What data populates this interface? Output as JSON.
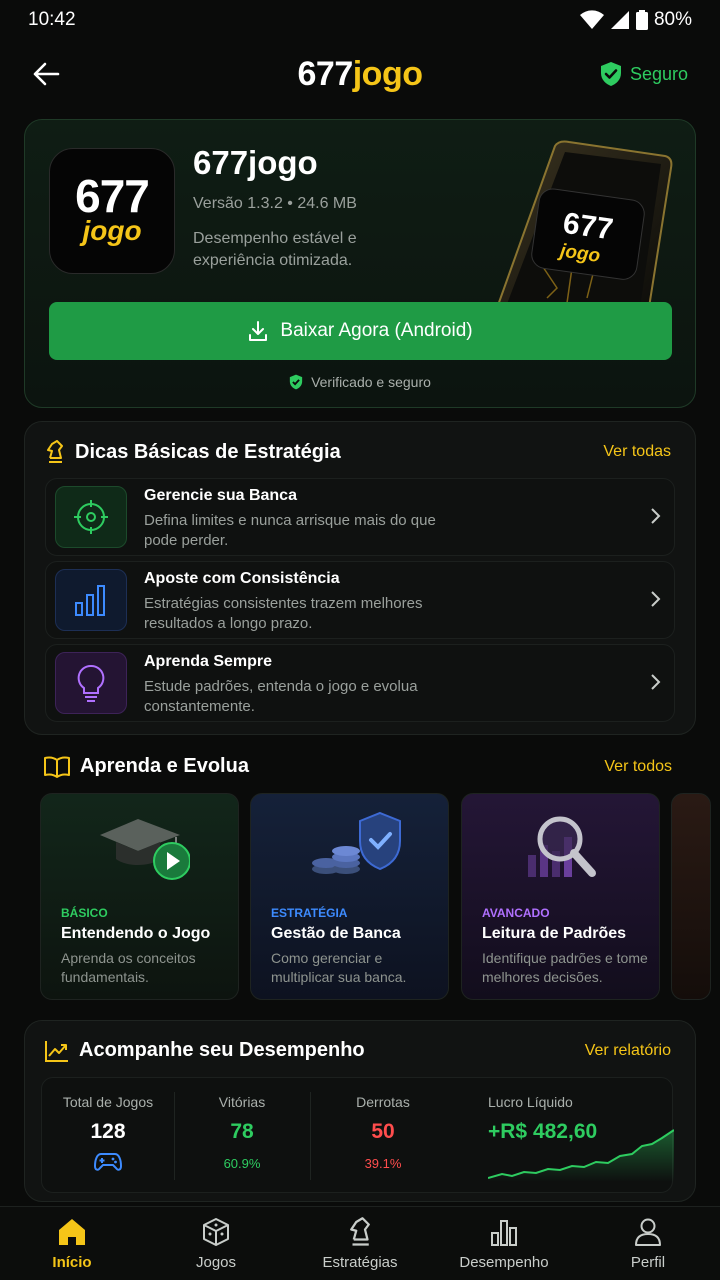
{
  "status": {
    "time": "10:42",
    "battery": "80%"
  },
  "appbar": {
    "brand_num": "677",
    "brand_word": "jogo",
    "safe_label": "Seguro"
  },
  "hero": {
    "icon_num": "677",
    "icon_word": "jogo",
    "name": "677jogo",
    "meta": "Versão 1.3.2  •  24.6 MB",
    "desc": "Desempenho estável e experiência otimizada.",
    "phone_num": "677",
    "phone_word": "jogo",
    "download_label": "Baixar Agora (Android)",
    "verified_label": "Verificado e seguro"
  },
  "tips": {
    "title": "Dicas Básicas de Estratégia",
    "link": "Ver todas",
    "items": [
      {
        "title": "Gerencie sua Banca",
        "sub": "Defina limites e nunca arrisque mais do que pode perder.",
        "icon": "target-icon"
      },
      {
        "title": "Aposte com Consistência",
        "sub": "Estratégias consistentes trazem melhores resultados a longo prazo.",
        "icon": "bar-chart-icon"
      },
      {
        "title": "Aprenda Sempre",
        "sub": "Estude padrões, entenda o jogo e evolua constantemente.",
        "icon": "lightbulb-icon"
      }
    ]
  },
  "learn": {
    "title": "Aprenda e Evolua",
    "link": "Ver todos",
    "cards": [
      {
        "tag": "BÁSICO",
        "title": "Entendendo o Jogo",
        "sub": "Aprenda os conceitos fundamentais.",
        "color": "#2ecc60"
      },
      {
        "tag": "ESTRATÉGIA",
        "title": "Gestão de Banca",
        "sub": "Como gerenciar e multiplicar sua banca.",
        "color": "#3d8bff"
      },
      {
        "tag": "AVANCADO",
        "title": "Leitura de Padrões",
        "sub": "Identifique padrões e tome melhores decisões.",
        "color": "#b070ff"
      }
    ]
  },
  "performance": {
    "title": "Acompanhe seu Desempenho",
    "link": "Ver relatório",
    "total_label": "Total de Jogos",
    "total_value": "128",
    "wins_label": "Vitórias",
    "wins_value": "78",
    "wins_pct": "60.9%",
    "losses_label": "Derrotas",
    "losses_value": "50",
    "losses_pct": "39.1%",
    "profit_label": "Lucro Líquido",
    "profit_value": "+R$ 482,60"
  },
  "nav": [
    {
      "label": "Início",
      "icon": "home-icon",
      "active": true
    },
    {
      "label": "Jogos",
      "icon": "dice-icon",
      "active": false
    },
    {
      "label": "Estratégias",
      "icon": "chess-knight-icon",
      "active": false
    },
    {
      "label": "Desempenho",
      "icon": "bar-chart-icon",
      "active": false
    },
    {
      "label": "Perfil",
      "icon": "user-icon",
      "active": false
    }
  ],
  "colors": {
    "accent": "#f5c518",
    "green": "#2ecc60",
    "red": "#ff4d4d",
    "button": "#1f9b45"
  }
}
